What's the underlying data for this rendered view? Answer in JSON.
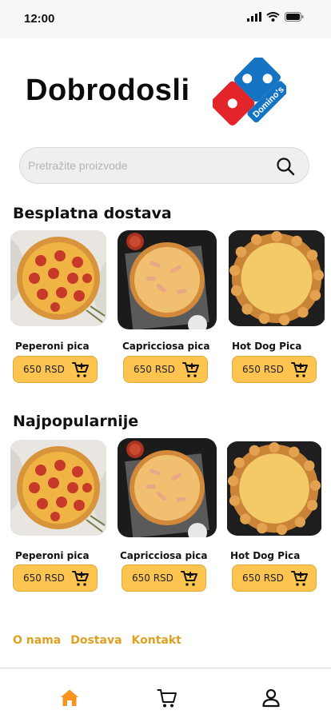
{
  "status_bar": {
    "time": "12:00",
    "icons": [
      "signal-icon",
      "wifi-icon",
      "battery-icon"
    ]
  },
  "header": {
    "title": "Dobrodosli",
    "logo_text": "Domino's Pizza",
    "logo_colors": {
      "blue": "#1474c3",
      "red": "#e3242b"
    }
  },
  "search": {
    "placeholder": "Pretražite proizvode",
    "value": "",
    "icon": "search-icon"
  },
  "sections": [
    {
      "title": "Besplatna dostava",
      "products": [
        {
          "name": "Peperoni pica",
          "price": "650 RSD",
          "image": "pepperoni-pizza"
        },
        {
          "name": "Capricciosa pica",
          "price": "650 RSD",
          "image": "capricciosa-pizza"
        },
        {
          "name": "Hot Dog Pica",
          "price": "650 RSD",
          "image": "hot-dog-pizza"
        }
      ]
    },
    {
      "title": "Najpopularnije",
      "products": [
        {
          "name": "Peperoni pica",
          "price": "650 RSD",
          "image": "pepperoni-pizza"
        },
        {
          "name": "Capricciosa pica",
          "price": "650 RSD",
          "image": "capricciosa-pizza"
        },
        {
          "name": "Hot Dog Pica",
          "price": "650 RSD",
          "image": "hot-dog-pizza"
        }
      ]
    }
  ],
  "footer": {
    "links": [
      "O nama",
      "Dostava",
      "Kontakt"
    ]
  },
  "bottom_nav": {
    "items": [
      "home-icon",
      "cart-icon",
      "user-icon"
    ],
    "active": "home-icon",
    "accent": "#f7931e"
  },
  "colors": {
    "price_button": "#fdc44f",
    "footer_link": "#e0a020"
  }
}
